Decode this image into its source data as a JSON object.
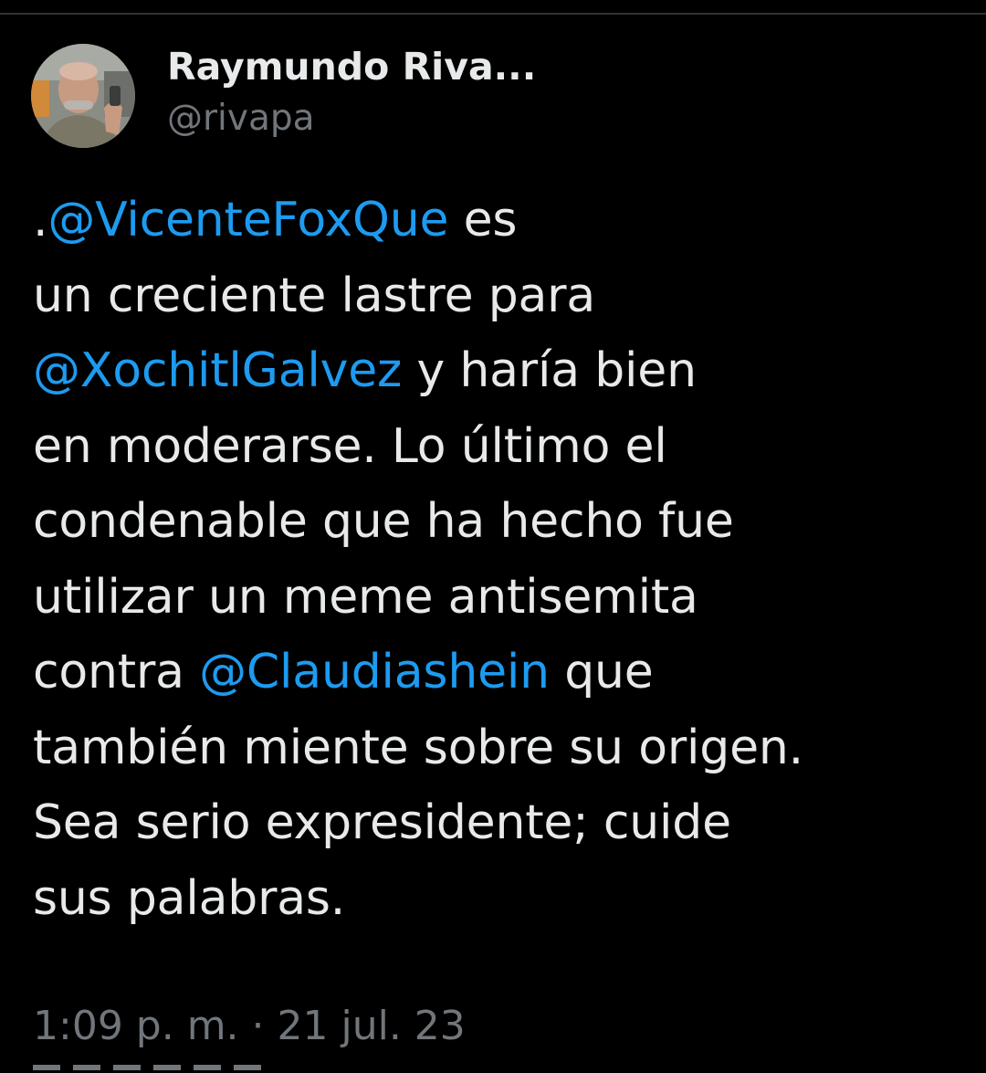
{
  "author": {
    "display_name": "Raymundo Riva...",
    "handle": "@rivapa",
    "avatar": "profile-photo"
  },
  "tweet": {
    "lines": [
      [
        {
          "text": ".",
          "type": "text"
        },
        {
          "text": "@VicenteFoxQue",
          "type": "mention"
        },
        {
          "text": " es",
          "type": "text"
        }
      ],
      [
        {
          "text": "un creciente lastre para",
          "type": "text"
        }
      ],
      [
        {
          "text": "@XochitlGalvez",
          "type": "mention"
        },
        {
          "text": " y haría bien",
          "type": "text"
        }
      ],
      [
        {
          "text": "en moderarse. Lo último el",
          "type": "text"
        }
      ],
      [
        {
          "text": "condenable que ha hecho fue",
          "type": "text"
        }
      ],
      [
        {
          "text": "utilizar un meme antisemita",
          "type": "text"
        }
      ],
      [
        {
          "text": "contra ",
          "type": "text"
        },
        {
          "text": "@Claudiashein",
          "type": "mention"
        },
        {
          "text": " que",
          "type": "text"
        }
      ],
      [
        {
          "text": "también miente sobre su origen.",
          "type": "text"
        }
      ],
      [
        {
          "text": "Sea serio expresidente; cuide",
          "type": "text"
        }
      ],
      [
        {
          "text": "sus palabras.",
          "type": "text"
        }
      ]
    ]
  },
  "timestamp": "1:09 p. m. · 21 jul. 23",
  "colors": {
    "background": "#000000",
    "text": "#e7e9ea",
    "secondary": "#71767b",
    "link": "#1d9bf0"
  }
}
